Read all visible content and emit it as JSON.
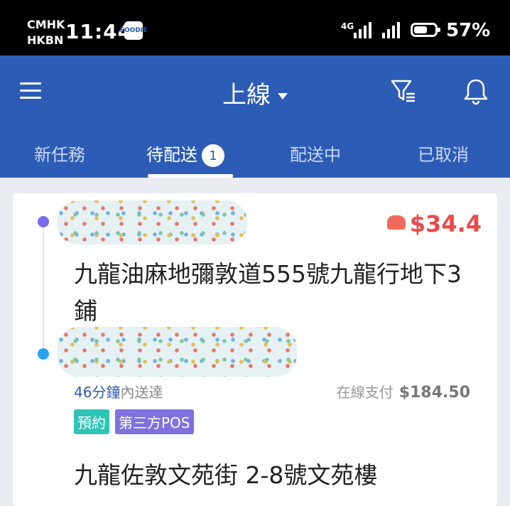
{
  "status_bar": {
    "carrier_1": "CMHK",
    "carrier_2": "HKBN",
    "time": "11:44",
    "app_badge": "FOODIE",
    "network": "4G",
    "battery_percent": "57%",
    "battery_level": 0.57
  },
  "header": {
    "title": "上線",
    "icons": [
      "menu-icon",
      "filter-icon",
      "bell-icon"
    ]
  },
  "tabs": [
    {
      "label": "新任務"
    },
    {
      "label": "待配送",
      "badge": "1",
      "active": true
    },
    {
      "label": "配送中"
    },
    {
      "label": "已取消"
    }
  ],
  "order": {
    "fee": "$34.4",
    "pickup_address": "九龍油麻地彌敦道555號九龍行地下3鋪",
    "eta_minutes": "46分鐘",
    "eta_suffix": "內送達",
    "payment_method": "在線支付",
    "payment_amount": "$184.50",
    "tags": [
      "預約",
      "第三方POS"
    ],
    "dropoff_address": "九龍佐敦文苑街 2-8號文苑樓"
  },
  "colors": {
    "primary": "#2d5cb6",
    "price": "#ea4a4a",
    "tag_teal": "#2ec4b6",
    "tag_purple": "#7e72e0"
  }
}
